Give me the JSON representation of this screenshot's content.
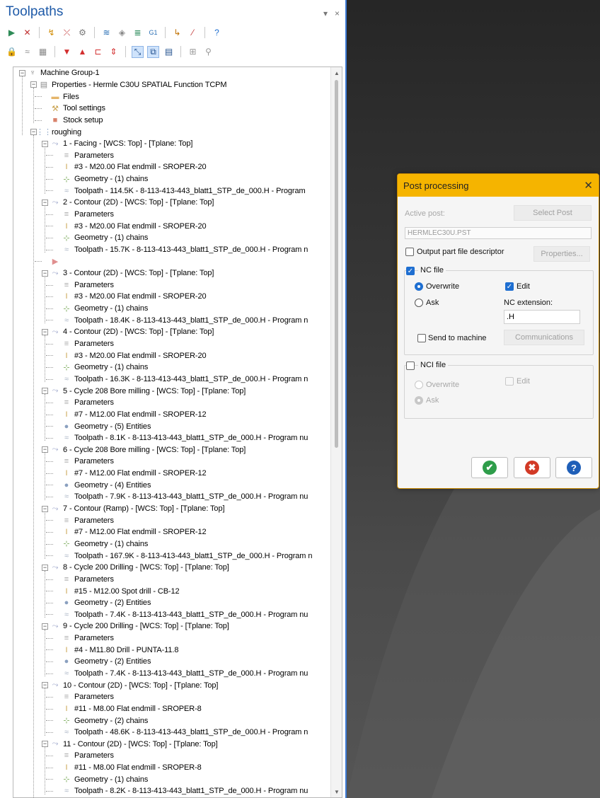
{
  "panel": {
    "title": "Toolpaths",
    "pin_glyph": "▾",
    "close_glyph": "×"
  },
  "toolbar1": [
    {
      "icon": "select-all-operations-icon",
      "glyph": "▶",
      "color": "#2e8b57"
    },
    {
      "icon": "deselect-operations-icon",
      "glyph": "✕",
      "color": "#c03030"
    },
    {
      "icon": "regenerate-selected-icon",
      "glyph": "↯",
      "color": "#d08a00"
    },
    {
      "icon": "regenerate-dirty-icon",
      "glyph": "⤫",
      "color": "#c03030"
    },
    {
      "icon": "simulate-toolpath-icon",
      "glyph": "⚙",
      "color": "#777"
    },
    {
      "icon": "backplot-icon",
      "glyph": "≋",
      "color": "#2a6fb5"
    },
    {
      "icon": "verify-icon",
      "glyph": "◈",
      "color": "#888"
    },
    {
      "icon": "simulator-icon",
      "glyph": "≣",
      "color": "#2a8a5a"
    },
    {
      "icon": "g1-post-icon",
      "glyph": "G1",
      "color": "#2a6fb5"
    },
    {
      "icon": "post-selected-icon",
      "glyph": "↳",
      "color": "#c07000"
    },
    {
      "icon": "highfeed-icon",
      "glyph": "⁄",
      "color": "#c03030"
    },
    {
      "icon": "help-icon",
      "glyph": "?",
      "color": "#1f6fd1"
    }
  ],
  "toolbar2": [
    {
      "icon": "lock-icon",
      "glyph": "🔒",
      "color": "#d29b00"
    },
    {
      "icon": "toggle-display-icon",
      "glyph": "≈",
      "color": "#888"
    },
    {
      "icon": "toggle-posting-icon",
      "glyph": "▦",
      "color": "#888"
    },
    {
      "icon": "move-down-icon",
      "glyph": "▼",
      "color": "#d32f2f"
    },
    {
      "icon": "move-up-icon",
      "glyph": "▲",
      "color": "#d32f2f"
    },
    {
      "icon": "insert-arrow-icon",
      "glyph": "⊏",
      "color": "#d32f2f"
    },
    {
      "icon": "scroll-to-insert-icon",
      "glyph": "⇕",
      "color": "#d32f2f"
    },
    {
      "icon": "display-only-selected-icon",
      "glyph": "⤡",
      "color": "#1f4e8c"
    },
    {
      "icon": "display-only-selected-group-icon",
      "glyph": "⧉",
      "color": "#1f4e8c"
    },
    {
      "icon": "display-options-icon",
      "glyph": "▤",
      "color": "#1f4e8c"
    },
    {
      "icon": "stock-model-icon",
      "glyph": "⊞",
      "color": "#999"
    },
    {
      "icon": "optimize-icon",
      "glyph": "⚲",
      "color": "#999"
    }
  ],
  "tree": [
    {
      "level": 0,
      "type": "machine",
      "label": "Machine Group-1",
      "exp": "−"
    },
    {
      "level": 1,
      "type": "properties",
      "label": "Properties - Hermle C30U SPATIAL Function TCPM",
      "exp": "−"
    },
    {
      "level": 2,
      "type": "folder",
      "label": "Files"
    },
    {
      "level": 2,
      "type": "toolset",
      "label": "Tool settings"
    },
    {
      "level": 2,
      "type": "stock",
      "label": "Stock setup"
    },
    {
      "level": 1,
      "type": "group",
      "label": "roughing",
      "exp": "−"
    },
    {
      "level": 2,
      "type": "op",
      "label": "1 - Facing - [WCS: Top] - [Tplane: Top]",
      "exp": "−"
    },
    {
      "level": 3,
      "type": "params",
      "label": "Parameters"
    },
    {
      "level": 3,
      "type": "tool",
      "label": "#3 - M20.00 Flat endmill - SROPER-20"
    },
    {
      "level": 3,
      "type": "geom",
      "label": "Geometry - (1) chains"
    },
    {
      "level": 3,
      "type": "path",
      "label": "Toolpath - 114.5K - 8-113-413-443_blatt1_STP_de_000.H - Program"
    },
    {
      "level": 2,
      "type": "op",
      "label": "2 - Contour (2D) - [WCS: Top] - [Tplane: Top]",
      "exp": "−"
    },
    {
      "level": 3,
      "type": "params",
      "label": "Parameters"
    },
    {
      "level": 3,
      "type": "tool",
      "label": "#3 - M20.00 Flat endmill - SROPER-20"
    },
    {
      "level": 3,
      "type": "geom",
      "label": "Geometry - (1) chains"
    },
    {
      "level": 3,
      "type": "path",
      "label": "Toolpath - 15.7K - 8-113-413-443_blatt1_STP_de_000.H - Program n"
    },
    {
      "level": 2,
      "type": "insert",
      "label": ""
    },
    {
      "level": 2,
      "type": "op",
      "label": "3 - Contour (2D) - [WCS: Top] - [Tplane: Top]",
      "exp": "−"
    },
    {
      "level": 3,
      "type": "params",
      "label": "Parameters"
    },
    {
      "level": 3,
      "type": "tool",
      "label": "#3 - M20.00 Flat endmill - SROPER-20"
    },
    {
      "level": 3,
      "type": "geom",
      "label": "Geometry - (1) chains"
    },
    {
      "level": 3,
      "type": "path",
      "label": "Toolpath - 18.4K - 8-113-413-443_blatt1_STP_de_000.H - Program n"
    },
    {
      "level": 2,
      "type": "op",
      "label": "4 - Contour (2D) - [WCS: Top] - [Tplane: Top]",
      "exp": "−"
    },
    {
      "level": 3,
      "type": "params",
      "label": "Parameters"
    },
    {
      "level": 3,
      "type": "tool",
      "label": "#3 - M20.00 Flat endmill - SROPER-20"
    },
    {
      "level": 3,
      "type": "geom",
      "label": "Geometry - (1) chains"
    },
    {
      "level": 3,
      "type": "path",
      "label": "Toolpath - 16.3K - 8-113-413-443_blatt1_STP_de_000.H - Program n"
    },
    {
      "level": 2,
      "type": "op",
      "label": "5 - Cycle 208 Bore milling - [WCS: Top] - [Tplane: Top]",
      "exp": "−"
    },
    {
      "level": 3,
      "type": "params",
      "label": "Parameters"
    },
    {
      "level": 3,
      "type": "tool",
      "label": "#7 - M12.00 Flat endmill - SROPER-12"
    },
    {
      "level": 3,
      "type": "entities",
      "label": "Geometry - (5) Entities"
    },
    {
      "level": 3,
      "type": "path",
      "label": "Toolpath - 8.1K - 8-113-413-443_blatt1_STP_de_000.H - Program nu"
    },
    {
      "level": 2,
      "type": "op",
      "label": "6 - Cycle 208 Bore milling - [WCS: Top] - [Tplane: Top]",
      "exp": "−"
    },
    {
      "level": 3,
      "type": "params",
      "label": "Parameters"
    },
    {
      "level": 3,
      "type": "tool",
      "label": "#7 - M12.00 Flat endmill - SROPER-12"
    },
    {
      "level": 3,
      "type": "entities",
      "label": "Geometry - (4) Entities"
    },
    {
      "level": 3,
      "type": "path",
      "label": "Toolpath - 7.9K - 8-113-413-443_blatt1_STP_de_000.H - Program nu"
    },
    {
      "level": 2,
      "type": "op",
      "label": "7 - Contour (Ramp) - [WCS: Top] - [Tplane: Top]",
      "exp": "−"
    },
    {
      "level": 3,
      "type": "params",
      "label": "Parameters"
    },
    {
      "level": 3,
      "type": "tool",
      "label": "#7 - M12.00 Flat endmill - SROPER-12"
    },
    {
      "level": 3,
      "type": "geom",
      "label": "Geometry - (1) chains"
    },
    {
      "level": 3,
      "type": "path",
      "label": "Toolpath - 167.9K - 8-113-413-443_blatt1_STP_de_000.H - Program n"
    },
    {
      "level": 2,
      "type": "op",
      "label": "8 - Cycle 200 Drilling - [WCS: Top] - [Tplane: Top]",
      "exp": "−"
    },
    {
      "level": 3,
      "type": "params",
      "label": "Parameters"
    },
    {
      "level": 3,
      "type": "tool",
      "label": "#15 - M12.00 Spot drill - CB-12"
    },
    {
      "level": 3,
      "type": "entities",
      "label": "Geometry - (2) Entities"
    },
    {
      "level": 3,
      "type": "path",
      "label": "Toolpath - 7.4K - 8-113-413-443_blatt1_STP_de_000.H - Program nu"
    },
    {
      "level": 2,
      "type": "op",
      "label": "9 - Cycle 200 Drilling - [WCS: Top] - [Tplane: Top]",
      "exp": "−"
    },
    {
      "level": 3,
      "type": "params",
      "label": "Parameters"
    },
    {
      "level": 3,
      "type": "tool",
      "label": "#4 - M11.80 Drill - PUNTA-11.8"
    },
    {
      "level": 3,
      "type": "entities",
      "label": "Geometry - (2) Entities"
    },
    {
      "level": 3,
      "type": "path",
      "label": "Toolpath - 7.4K - 8-113-413-443_blatt1_STP_de_000.H - Program nu"
    },
    {
      "level": 2,
      "type": "op",
      "label": "10 - Contour (2D) - [WCS: Top] - [Tplane: Top]",
      "exp": "−"
    },
    {
      "level": 3,
      "type": "params",
      "label": "Parameters"
    },
    {
      "level": 3,
      "type": "tool",
      "label": "#11 - M8.00 Flat endmill - SROPER-8"
    },
    {
      "level": 3,
      "type": "geom",
      "label": "Geometry - (2) chains"
    },
    {
      "level": 3,
      "type": "path",
      "label": "Toolpath - 48.6K - 8-113-413-443_blatt1_STP_de_000.H - Program n"
    },
    {
      "level": 2,
      "type": "op",
      "label": "11 - Contour (2D) - [WCS: Top] - [Tplane: Top]",
      "exp": "−"
    },
    {
      "level": 3,
      "type": "params",
      "label": "Parameters"
    },
    {
      "level": 3,
      "type": "tool",
      "label": "#11 - M8.00 Flat endmill - SROPER-8"
    },
    {
      "level": 3,
      "type": "geom",
      "label": "Geometry - (1) chains"
    },
    {
      "level": 3,
      "type": "path",
      "label": "Toolpath - 8.2K - 8-113-413-443_blatt1_STP_de_000.H - Program nu"
    }
  ],
  "dialog": {
    "title": "Post processing",
    "close_glyph": "✕",
    "active_post_label": "Active post:",
    "select_post_button": "Select Post",
    "active_post_value": "HERMLEC30U.PST",
    "output_descriptor_label": "Output part file descriptor",
    "output_descriptor_checked": false,
    "properties_button": "Properties...",
    "nc_file": {
      "label": "NC file",
      "checked": true,
      "overwrite_label": "Overwrite",
      "ask_label": "Ask",
      "edit_label": "Edit",
      "edit_checked": true,
      "extension_label": "NC extension:",
      "extension_value": ".H",
      "send_label": "Send to machine",
      "send_checked": false,
      "communications_button": "Communications"
    },
    "nci_file": {
      "label": "NCI file",
      "checked": false,
      "overwrite_label": "Overwrite",
      "ask_label": "Ask",
      "edit_label": "Edit"
    },
    "buttons": {
      "ok_glyph": "✔",
      "cancel_glyph": "✖",
      "help_glyph": "?",
      "ok_color": "#2e9d4a",
      "cancel_color": "#d23a26",
      "help_color": "#1f5fb8"
    }
  },
  "scrollbar": {
    "up_glyph": "▲",
    "down_glyph": "▼"
  }
}
